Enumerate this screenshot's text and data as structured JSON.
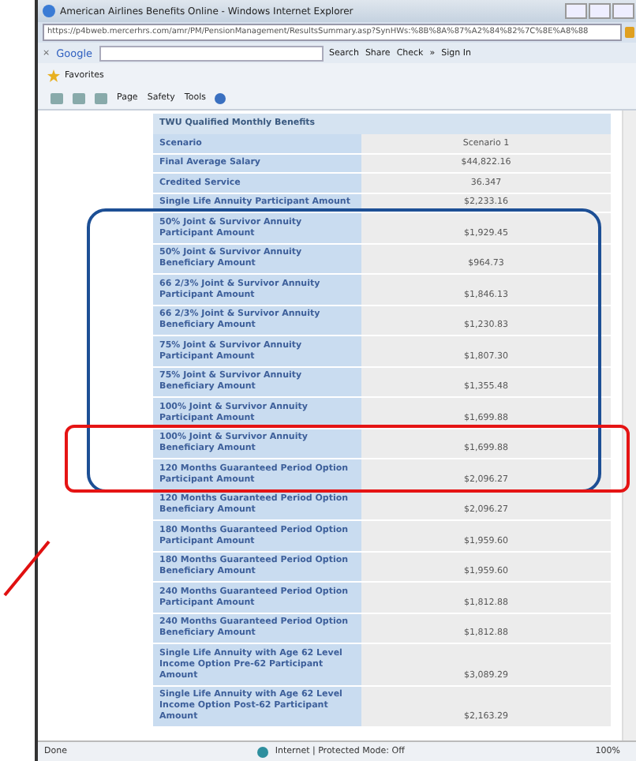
{
  "window": {
    "title": "American Airlines Benefits Online - Windows Internet Explorer"
  },
  "address_bar": {
    "url": "https://p4bweb.mercerhrs.com/amr/PM/PensionManagement/ResultsSummary.asp?SynHWs:%8B%8A%87%A2%84%82%7C%8E%A8%88"
  },
  "google_toolbar": {
    "close": "×",
    "logo": "Google",
    "buttons": [
      "Search",
      "Share",
      "Check",
      "»",
      "Sign In"
    ]
  },
  "favorites_bar": {
    "label": "Favorites"
  },
  "command_bar": {
    "menus": [
      "Page",
      "Safety",
      "Tools"
    ]
  },
  "table": {
    "title": "TWU Qualified Monthly Benefits",
    "rows": [
      {
        "label": "Scenario",
        "value": "Scenario 1"
      },
      {
        "label": "Final Average Salary",
        "value": "$44,822.16"
      },
      {
        "label": "Credited Service",
        "value": "36.347"
      },
      {
        "label": "Single Life Annuity Participant Amount",
        "value": "$2,233.16"
      },
      {
        "label": "50% Joint & Survivor Annuity Participant Amount",
        "value": "$1,929.45"
      },
      {
        "label": "50% Joint & Survivor Annuity Beneficiary Amount",
        "value": "$964.73"
      },
      {
        "label": "66 2/3% Joint & Survivor Annuity Participant Amount",
        "value": "$1,846.13"
      },
      {
        "label": "66 2/3% Joint & Survivor Annuity Beneficiary Amount",
        "value": "$1,230.83"
      },
      {
        "label": "75% Joint & Survivor Annuity Participant Amount",
        "value": "$1,807.30"
      },
      {
        "label": "75% Joint & Survivor Annuity Beneficiary Amount",
        "value": "$1,355.48"
      },
      {
        "label": "100% Joint & Survivor Annuity Participant Amount",
        "value": "$1,699.88"
      },
      {
        "label": "100% Joint & Survivor Annuity Beneficiary Amount",
        "value": "$1,699.88"
      },
      {
        "label": "120 Months Guaranteed Period Option Participant Amount",
        "value": "$2,096.27"
      },
      {
        "label": "120 Months Guaranteed Period Option Beneficiary Amount",
        "value": "$2,096.27"
      },
      {
        "label": "180 Months Guaranteed Period Option Participant Amount",
        "value": "$1,959.60"
      },
      {
        "label": "180 Months Guaranteed Period Option Beneficiary Amount",
        "value": "$1,959.60"
      },
      {
        "label": "240 Months Guaranteed Period Option Participant Amount",
        "value": "$1,812.88"
      },
      {
        "label": "240 Months Guaranteed Period Option Beneficiary Amount",
        "value": "$1,812.88"
      },
      {
        "label": "Single Life Annuity with Age 62 Level Income Option Pre-62 Participant Amount",
        "value": "$3,089.29"
      },
      {
        "label": "Single Life Annuity with Age 62 Level Income Option Post-62 Participant Amount",
        "value": "$2,163.29"
      }
    ]
  },
  "status_bar": {
    "status": "Done",
    "zone": "Internet | Protected Mode: Off",
    "zoom": "100%"
  }
}
